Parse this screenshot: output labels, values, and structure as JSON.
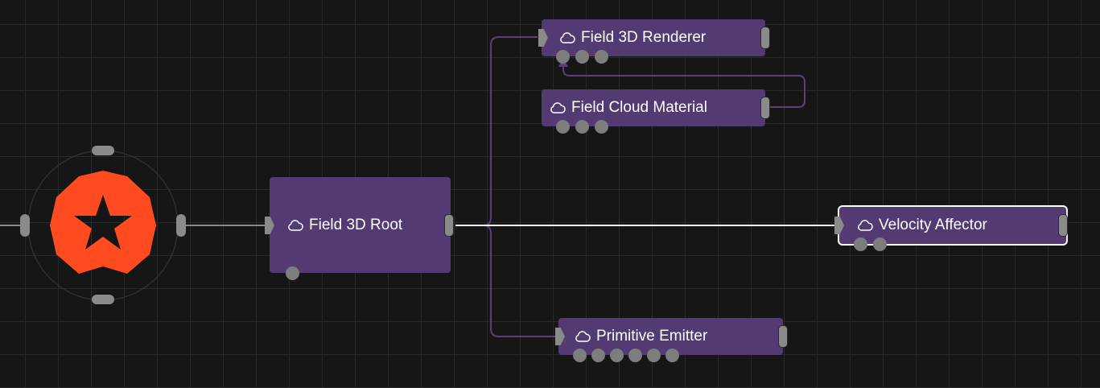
{
  "nodes": {
    "renderer": {
      "label": "Field 3D Renderer"
    },
    "material": {
      "label": "Field Cloud Material"
    },
    "root": {
      "label": "Field 3D Root"
    },
    "velocity": {
      "label": "Velocity Affector"
    },
    "emitter": {
      "label": "Primitive Emitter"
    }
  },
  "colors": {
    "background": "#161616",
    "grid": "#2a2a2a",
    "node": "#533a72",
    "wire_inactive": "#5a3f7a",
    "wire_active": "#ffffff",
    "root_wire": "#8a8a8a",
    "logo": "#ff4b1f",
    "port": "#8a8a8a"
  },
  "icons": {
    "node_icon": "cloud-icon",
    "scene_root_icon": "scene-logo-icon"
  }
}
